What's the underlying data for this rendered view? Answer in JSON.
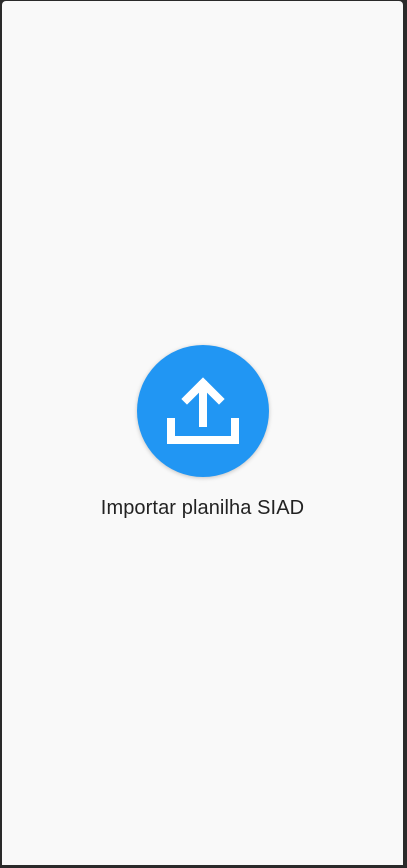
{
  "screen": {
    "background": "#f9f9f9",
    "frame_color": "#2a2a2a"
  },
  "import_action": {
    "icon": "upload-icon",
    "button_color": "#2196f3",
    "icon_color": "#ffffff",
    "label": "Importar planilha SIAD"
  }
}
